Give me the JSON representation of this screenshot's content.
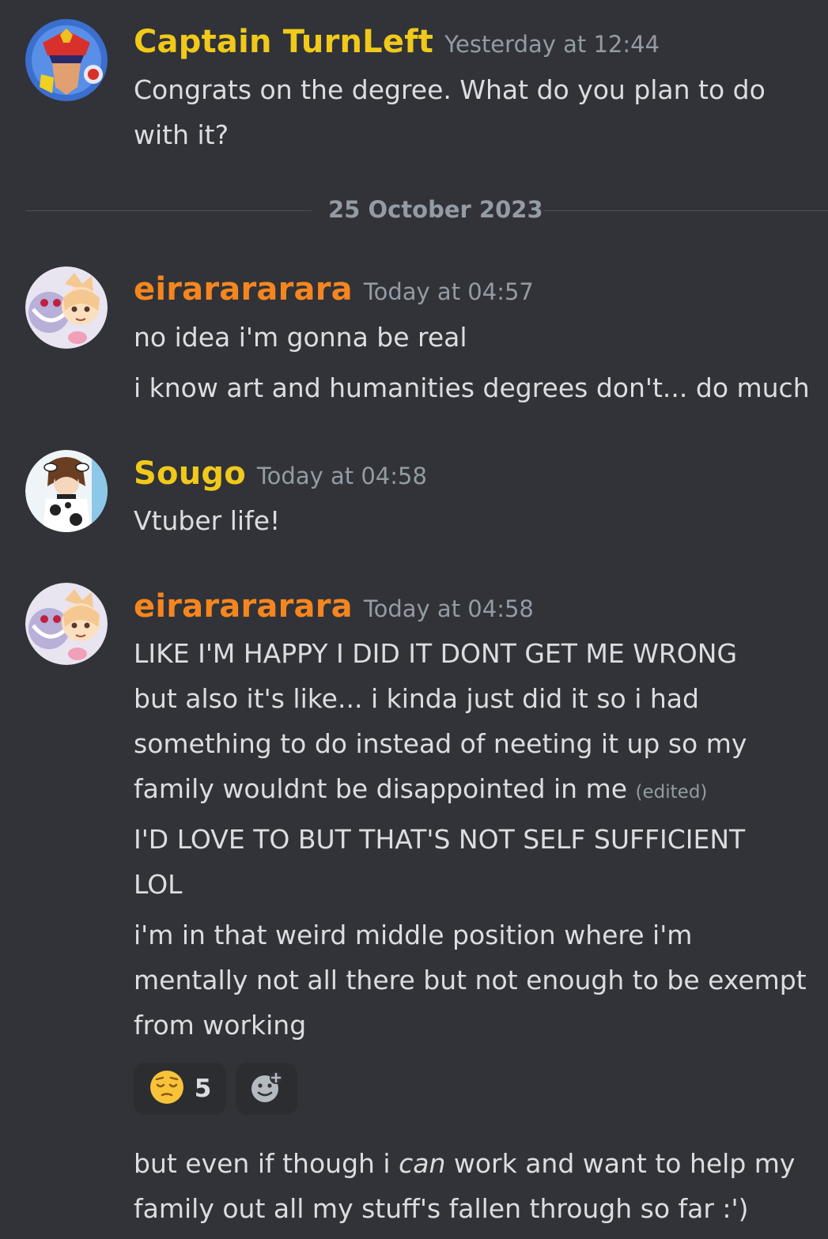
{
  "colors": {
    "background": "#313338",
    "username_yellow": "#f0c91a",
    "username_orange": "#f5861f",
    "text": "#dbdee1",
    "muted": "#949ba4"
  },
  "messages": [
    {
      "username": "Captain TurnLeft",
      "timestamp": "Yesterday at 12:44",
      "lines": [
        "Congrats on the degree. What do you plan to do",
        "with it?"
      ]
    },
    {
      "username": "eirarararara",
      "timestamp": "Today at 04:57",
      "lines": [
        "no idea i'm gonna be real",
        "i know art and humanities degrees don't... do much"
      ]
    },
    {
      "username": "Sougo",
      "timestamp": "Today at 04:58",
      "lines": [
        "Vtuber life!"
      ]
    },
    {
      "username": "eirarararara",
      "timestamp": "Today at 04:58",
      "lines": [
        "LIKE I'M HAPPY I DID IT DONT GET ME WRONG",
        "but also it's like... i kinda just did it so i had",
        "something to do instead of neeting it up so my",
        "family wouldnt be disappointed in me",
        "I'D LOVE TO BUT THAT'S NOT SELF SUFFICIENT",
        "LOL",
        "i'm in that weird middle position where i'm",
        "mentally not all there but not enough to be exempt",
        "from working"
      ],
      "edited_label": "(edited)",
      "trailing": {
        "before": "but even if though i ",
        "emphasis": "can",
        "after": " work and want to help my",
        "line2": "family out all my stuff's fallen through so far :')"
      }
    }
  ],
  "divider": {
    "date": "25 October 2023"
  },
  "reactions": [
    {
      "icon": "pensive-face-icon",
      "count": "5"
    },
    {
      "icon": "add-reaction-icon"
    }
  ]
}
